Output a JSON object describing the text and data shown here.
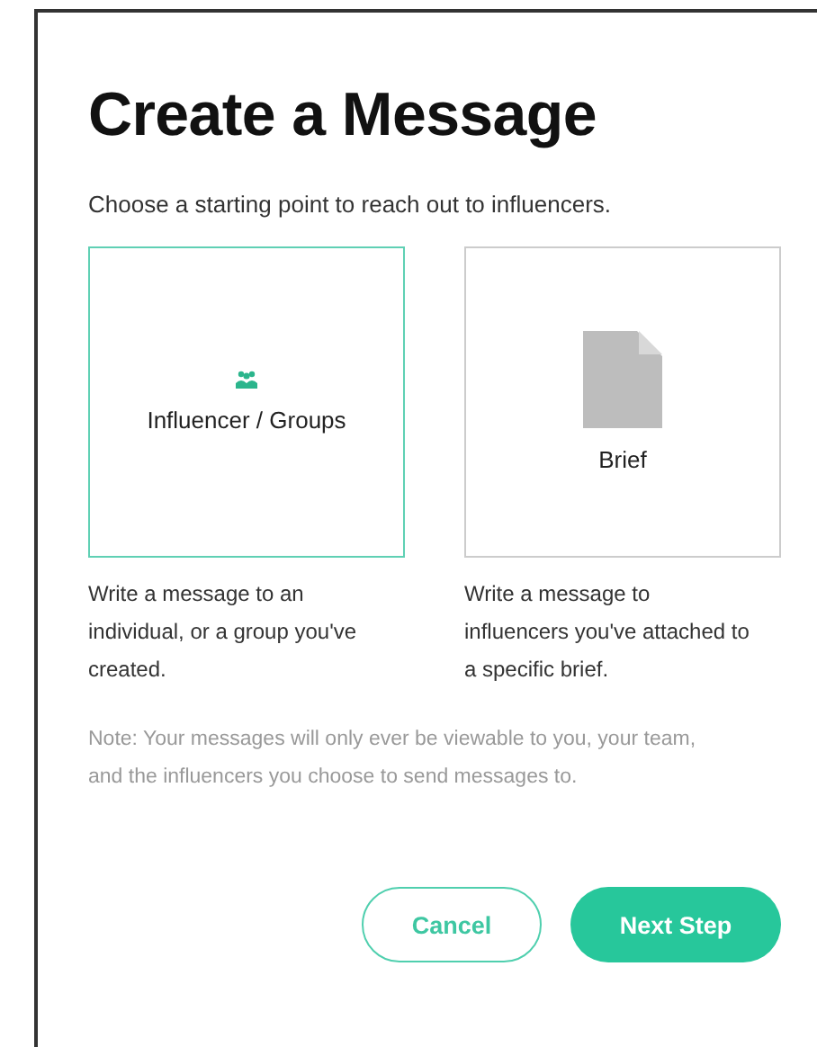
{
  "title": "Create a Message",
  "subtitle": "Choose a starting point to reach out to influencers.",
  "options": [
    {
      "label": "Influencer / Groups",
      "kind": "group",
      "selected": true,
      "description": "Write a message to an individual, or a group you've created."
    },
    {
      "label": "Brief",
      "kind": "document",
      "selected": false,
      "description": "Write a message to influencers you've attached to a specific brief."
    }
  ],
  "note": "Note: Your messages will only ever be viewable to you, your team, and the influencers you choose to send messages to.",
  "buttons": [
    {
      "label": "Cancel",
      "kind": "secondary"
    },
    {
      "label": "Next Step",
      "kind": "primary"
    }
  ]
}
